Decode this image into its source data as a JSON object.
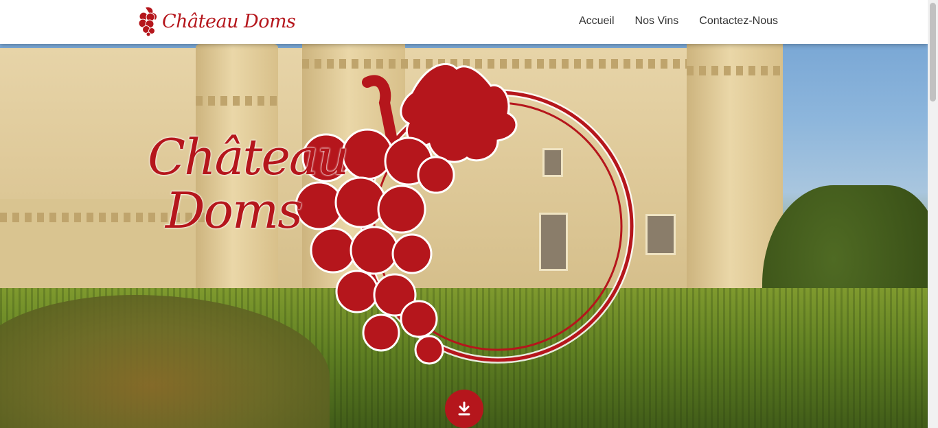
{
  "brand": {
    "name": "Château Doms"
  },
  "nav": {
    "items": [
      {
        "label": "Accueil"
      },
      {
        "label": "Nos Vins"
      },
      {
        "label": "Contactez-Nous"
      }
    ]
  },
  "hero": {
    "logo_line1": "Château",
    "logo_line2": "Doms"
  },
  "icons": {
    "brand": "grape-icon",
    "down": "download-arrow-icon"
  },
  "colors": {
    "accent": "#b5161c",
    "nav_text": "#333333"
  }
}
